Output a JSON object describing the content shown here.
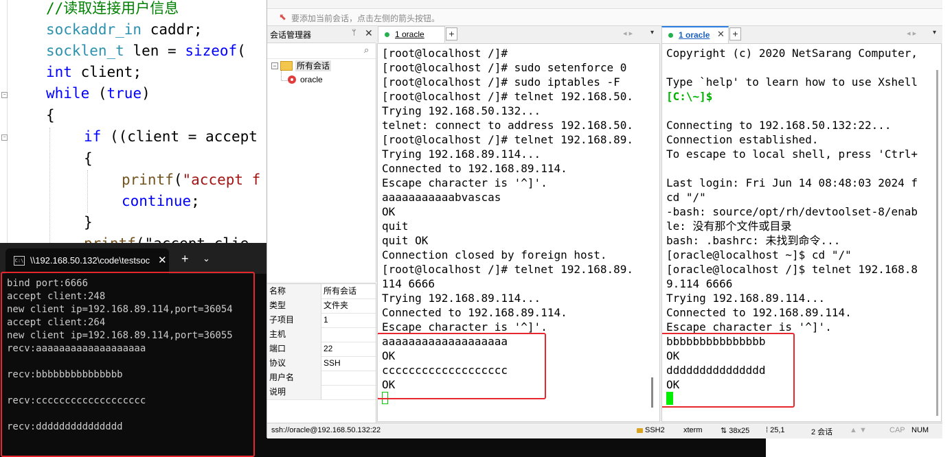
{
  "editor": {
    "lines": [
      {
        "comment": "//读取连接用户信息"
      },
      {
        "type": "sockaddr_in",
        "rest": " caddr;"
      },
      {
        "type": "socklen_t",
        "rest": " len = ",
        "fn": "sizeof",
        "tail": "("
      },
      {
        "kw": "int",
        "rest": " client;"
      },
      {
        "kw": "while",
        "rest": " (",
        "kw2": "true",
        "tail": ")"
      },
      {
        "plain": "{"
      },
      {
        "kw": "if",
        "rest": " ((client = accept"
      },
      {
        "plain": "{"
      },
      {
        "fn": "printf",
        "rest": "(",
        "str": "\"accept f"
      },
      {
        "kw": "continue",
        "rest": ";"
      },
      {
        "plain": "}"
      },
      {
        "fn": "printf",
        "rest": "(\"accept clie"
      }
    ]
  },
  "windows_terminal": {
    "tab_title": "\\\\192.168.50.132\\code\\testsoc",
    "tab_close": "✕",
    "add_tab": "+",
    "dropdown": "⌄",
    "lines": [
      "bind port:6666",
      "accept client:248",
      "new client ip=192.168.89.114,port=36054",
      "accept client:264",
      "new client ip=192.168.89.114,port=36055",
      "recv:aaaaaaaaaaaaaaaaaaa",
      "",
      "recv:bbbbbbbbbbbbbbb",
      "",
      "recv:ccccccccccccccccccc",
      "",
      "recv:ddddddddddddddd"
    ]
  },
  "xshell": {
    "hint_text": "要添加当前会话，点击左侧的箭头按钮。",
    "session_manager": {
      "title": "会话管理器",
      "pin": "ᛘ",
      "close": "✕",
      "search_icon": "⌕",
      "tree": {
        "expander": "−",
        "folder": "所有会话",
        "session": "oracle"
      },
      "properties": [
        {
          "key": "名称",
          "value": "所有会话"
        },
        {
          "key": "类型",
          "value": "文件夹"
        },
        {
          "key": "子项目",
          "value": "1"
        },
        {
          "key": "主机",
          "value": ""
        },
        {
          "key": "端口",
          "value": "22"
        },
        {
          "key": "协议",
          "value": "SSH"
        },
        {
          "key": "用户名",
          "value": ""
        },
        {
          "key": "说明",
          "value": ""
        }
      ]
    },
    "left_pane": {
      "tab_label": "1 oracle",
      "tab_close": "✕",
      "add": "+",
      "nav": "◂ ▸",
      "menu": "▾",
      "lines_before": [
        "[root@localhost /]#",
        "[root@localhost /]# sudo setenforce 0",
        "[root@localhost /]# sudo iptables -F",
        "[root@localhost /]# telnet 192.168.50.",
        "Trying 192.168.50.132...",
        "telnet: connect to address 192.168.50.",
        "[root@localhost /]# telnet 192.168.89.",
        "Trying 192.168.89.114...",
        "Connected to 192.168.89.114.",
        "Escape character is '^]'.",
        "aaaaaaaaaaabvascas",
        "OK",
        "quit",
        "quit OK",
        "Connection closed by foreign host.",
        "[root@localhost /]# telnet 192.168.89.",
        "114 6666",
        "Trying 192.168.89.114...",
        "Connected to 192.168.89.114.",
        "Escape character is '^]'."
      ],
      "lines_boxed": [
        "aaaaaaaaaaaaaaaaaaa",
        "OK",
        "ccccccccccccccccccc",
        "OK"
      ]
    },
    "right_pane": {
      "tab_label": "1 oracle",
      "tab_close": "✕",
      "add": "+",
      "nav": "◂ ▸",
      "menu": "▾",
      "lines_before": [
        "Copyright (c) 2020 NetSarang Computer,",
        "",
        "Type `help' to learn how to use Xshell",
        "[C:\\~]$",
        "",
        "Connecting to 192.168.50.132:22...",
        "Connection established.",
        "To escape to local shell, press 'Ctrl+",
        "",
        "Last login: Fri Jun 14 08:48:03 2024 f",
        "cd \"/\"",
        "-bash: source/opt/rh/devtoolset-8/enab",
        "le: 没有那个文件或目录",
        "bash: .bashrc: 未找到命令...",
        "[oracle@localhost ~]$ cd \"/\"",
        "[oracle@localhost /]$ telnet 192.168.8",
        "9.114 6666",
        "Trying 192.168.89.114...",
        "Connected to 192.168.89.114.",
        "Escape character is '^]'."
      ],
      "lines_boxed": [
        "bbbbbbbbbbbbbbb",
        "OK",
        "ddddddddddddddd",
        "OK"
      ]
    },
    "status_bar": {
      "connection": "ssh://oracle@192.168.50.132:22",
      "protocol": "SSH2",
      "term": "xterm",
      "size": "38x25",
      "position": "25,1",
      "sessions": "2 会话",
      "arrows": "▲ ▼",
      "caps": "CAP",
      "num": "NUM"
    },
    "colors": {
      "highlight_box": "#e8262d",
      "prompt_green": "#00b000",
      "cursor_green": "#00ee00",
      "tab_dot": "#22b14c"
    }
  }
}
